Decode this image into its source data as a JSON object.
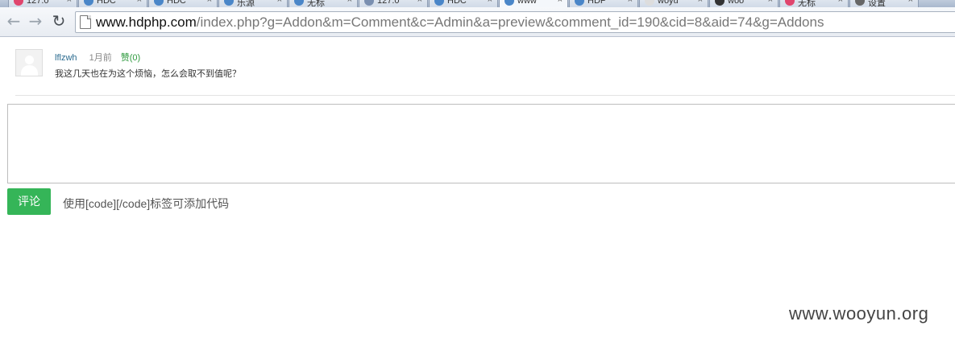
{
  "browser": {
    "tabs": [
      {
        "title": "127.0",
        "icon": "circle-pink-icon",
        "active": false
      },
      {
        "title": "HDC",
        "icon": "hd-logo-icon",
        "active": false
      },
      {
        "title": "HDC",
        "icon": "hd-logo-icon",
        "active": false
      },
      {
        "title": "乐源",
        "icon": "hd-logo-icon",
        "active": false
      },
      {
        "title": "无标",
        "icon": "hd-logo-icon",
        "active": false
      },
      {
        "title": "127.0",
        "icon": "pma-logo-icon",
        "active": false
      },
      {
        "title": "HDC",
        "icon": "hd-logo-icon",
        "active": false
      },
      {
        "title": "www",
        "icon": "hd-logo-icon",
        "active": true
      },
      {
        "title": "HDP",
        "icon": "hd-logo-icon",
        "active": false
      },
      {
        "title": "woyu",
        "icon": "page-icon",
        "active": false
      },
      {
        "title": "woo",
        "icon": "dark-square-icon",
        "active": false
      },
      {
        "title": "无标",
        "icon": "circle-pink-icon",
        "active": false
      },
      {
        "title": "设置",
        "icon": "gear-icon",
        "active": false
      }
    ],
    "close_glyph": "×",
    "url_host": "www.hdphp.com",
    "url_path": "/index.php?g=Addon&m=Comment&c=Admin&a=preview&comment_id=190&cid=8&aid=74&g=Addons"
  },
  "comment": {
    "username": "lflzwh",
    "time": "1月前",
    "like_label": "赞(0)",
    "text": "我这几天也在为这个烦恼，怎么会取不到值呢？"
  },
  "form": {
    "textarea_value": "",
    "submit_label": "评论",
    "hint": "使用[code][/code]标签可添加代码"
  },
  "watermark": "www.wooyun.org",
  "colors": {
    "accent_green": "#35b558",
    "username_blue": "#2b6b8f",
    "like_green": "#2e9a3e"
  }
}
